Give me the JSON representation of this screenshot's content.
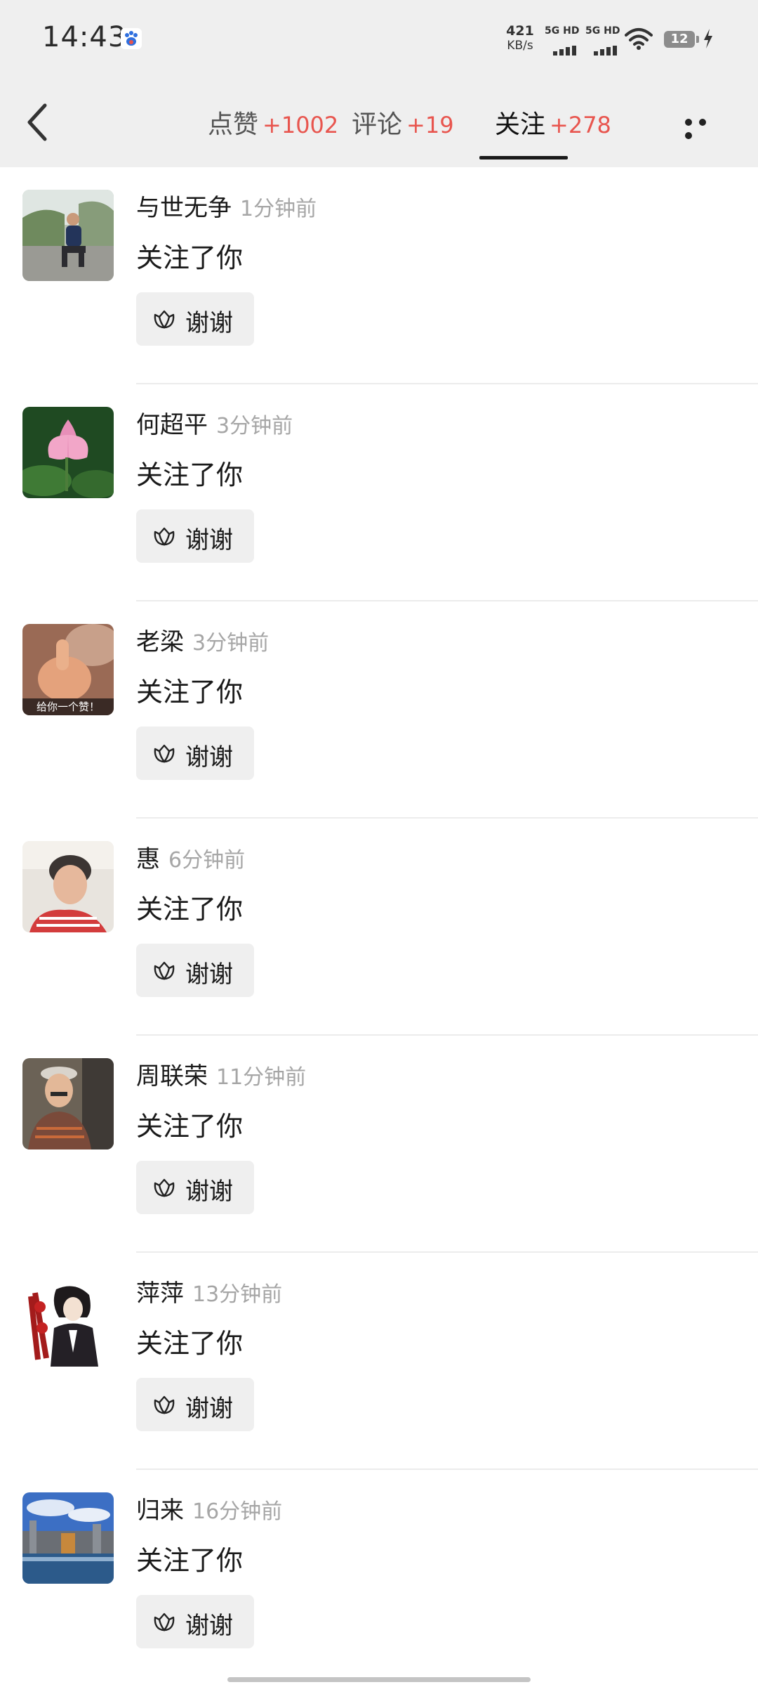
{
  "status_bar": {
    "time": "14:43",
    "app_icon": "baidu-paw-icon",
    "net_speed_value": "421",
    "net_speed_unit": "KB/s",
    "sim1_label": "5G HD",
    "sim2_label": "5G HD",
    "battery": "12",
    "wifi_icon": "wifi-icon",
    "charging_icon": "bolt-icon"
  },
  "nav": {
    "back_icon": "chevron-left-icon",
    "more_icon": "more-horizontal-icon",
    "tabs": [
      {
        "label": "点赞",
        "count": "+1002",
        "active": false
      },
      {
        "label": "评论",
        "count": "+19",
        "active": false
      },
      {
        "label": "关注",
        "count": "+278",
        "active": true
      }
    ]
  },
  "theme": {
    "accent_red": "#e8554e",
    "bar_bg": "#efefef",
    "button_bg": "#efefef"
  },
  "items": [
    {
      "name": "与世无争",
      "time": "1分钟前",
      "action": "关注了你",
      "button": "谢谢"
    },
    {
      "name": "何超平",
      "time": "3分钟前",
      "action": "关注了你",
      "button": "谢谢"
    },
    {
      "name": "老梁",
      "time": "3分钟前",
      "action": "关注了你",
      "button": "谢谢",
      "avatar_caption": "给你一个赞！"
    },
    {
      "name": "惠",
      "time": "6分钟前",
      "action": "关注了你",
      "button": "谢谢"
    },
    {
      "name": "周联荣",
      "time": "11分钟前",
      "action": "关注了你",
      "button": "谢谢"
    },
    {
      "name": "萍萍",
      "time": "13分钟前",
      "action": "关注了你",
      "button": "谢谢"
    },
    {
      "name": "归来",
      "time": "16分钟前",
      "action": "关注了你",
      "button": "谢谢"
    }
  ]
}
